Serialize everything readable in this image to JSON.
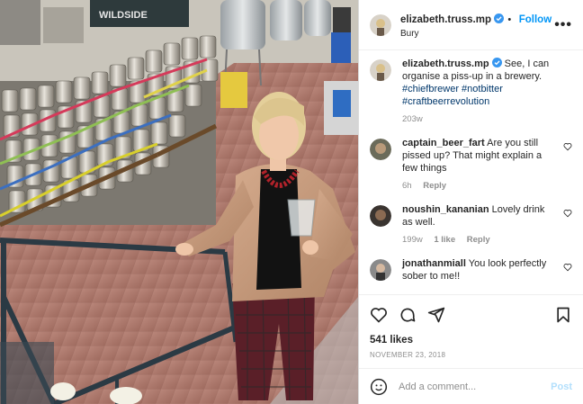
{
  "post": {
    "username": "elizabeth.truss.mp",
    "follow_label": "Follow",
    "location": "Bury",
    "photo_sign_text": "WILDSIDE"
  },
  "caption": {
    "username": "elizabeth.truss.mp",
    "text": "See, I can organise a piss-up in a brewery.",
    "hashtags": "#chiefbrewer #notbitter #craftbeerrevolution",
    "time": "203w"
  },
  "comments": [
    {
      "username": "captain_beer_fart",
      "text": "Are you still pissed up? That might explain a few things",
      "time": "6h",
      "reply": "Reply",
      "likes": ""
    },
    {
      "username": "noushin_kananian",
      "text": "Lovely drink as well.",
      "time": "199w",
      "likes": "1 like",
      "reply": "Reply"
    },
    {
      "username": "jonathanmiall",
      "text": "You look perfectly sober to me!!",
      "time": "",
      "likes": "",
      "reply": ""
    }
  ],
  "likes": "541 likes",
  "date": "NOVEMBER 23, 2018",
  "add_comment": {
    "placeholder": "Add a comment...",
    "post_label": "Post"
  },
  "colors": {
    "accent": "#0095f6",
    "verified": "#3897f0",
    "post_disabled": "#b2dffc",
    "meta": "#8e8e8e"
  },
  "icons": [
    "verified-badge-icon",
    "more-options-icon",
    "heart-icon",
    "comment-icon",
    "share-icon",
    "bookmark-icon",
    "emoji-icon"
  ]
}
